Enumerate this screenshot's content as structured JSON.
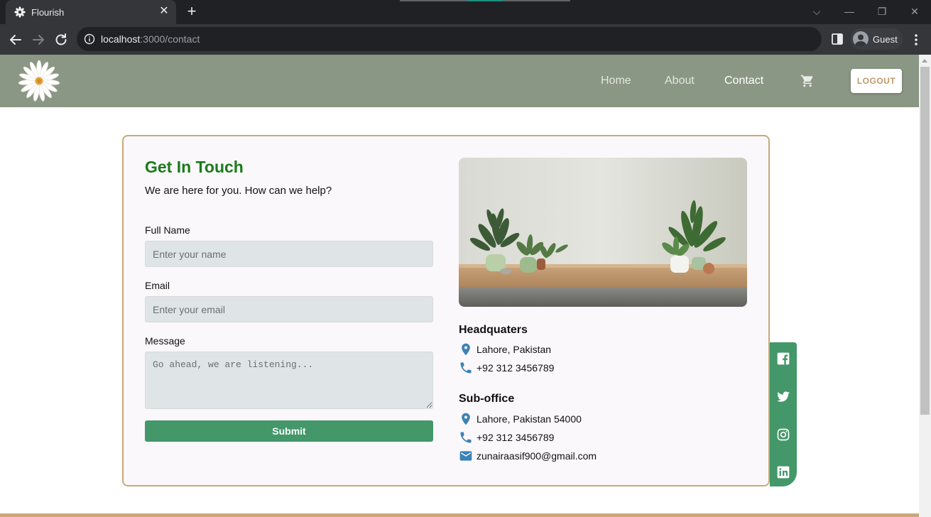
{
  "browser": {
    "tab_title": "Flourish",
    "url_host": "localhost",
    "url_rest": ":3000/contact",
    "profile_name": "Guest"
  },
  "header": {
    "nav": [
      {
        "label": "Home",
        "active": false
      },
      {
        "label": "About",
        "active": false
      },
      {
        "label": "Contact",
        "active": true
      }
    ],
    "logout_label": "LOGOUT",
    "colors": {
      "header_bg": "#8a9784",
      "logout_text": "#c09a6b"
    }
  },
  "contact": {
    "title": "Get In Touch",
    "subtitle": "We are here for you. How can we help?",
    "form": {
      "name_label": "Full Name",
      "name_placeholder": "Enter your name",
      "email_label": "Email",
      "email_placeholder": "Enter your email",
      "message_label": "Message",
      "message_placeholder": "Go ahead, we are listening...",
      "submit_label": "Submit"
    },
    "headquarters": {
      "title": "Headquaters",
      "address": "Lahore, Pakistan",
      "phone": "+92 312 3456789"
    },
    "suboffice": {
      "title": "Sub-office",
      "address": "Lahore, Pakistan 54000",
      "phone": "+92 312 3456789",
      "email": "zunairaasif900@gmail.com"
    }
  },
  "social": [
    "facebook-icon",
    "twitter-icon",
    "instagram-icon",
    "linkedin-icon"
  ],
  "colors": {
    "accent_green": "#439769",
    "title_green": "#1a7a1a",
    "card_border": "#c9a978",
    "icon_blue": "#3b82b6"
  }
}
